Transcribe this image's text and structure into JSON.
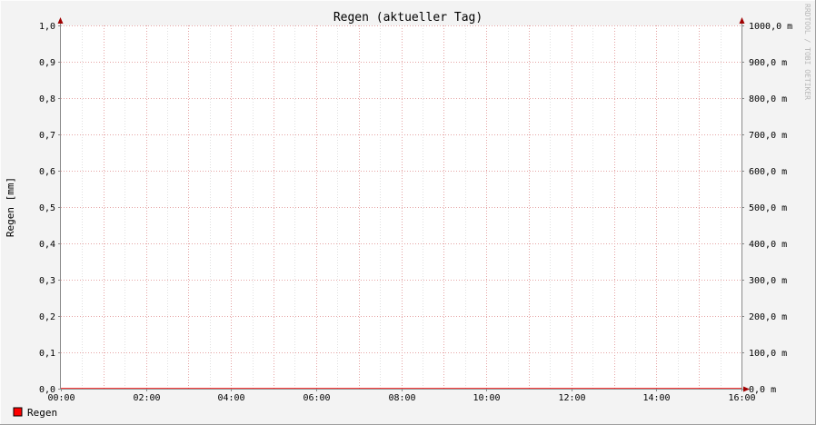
{
  "chart_data": {
    "type": "line",
    "title": "Regen (aktueller Tag)",
    "ylabel": "Regen [mm]",
    "x_ticks": [
      "00:00",
      "02:00",
      "04:00",
      "06:00",
      "08:00",
      "10:00",
      "12:00",
      "14:00",
      "16:00"
    ],
    "xlim": [
      "00:00",
      "16:00"
    ],
    "y_ticks": [
      "0,0",
      "0,1",
      "0,2",
      "0,3",
      "0,4",
      "0,5",
      "0,6",
      "0,7",
      "0,8",
      "0,9",
      "1,0"
    ],
    "ylim": [
      0,
      1.0
    ],
    "y2_ticks": [
      "0,0 m",
      "100,0 m",
      "200,0 m",
      "300,0 m",
      "400,0 m",
      "500,0 m",
      "600,0 m",
      "700,0 m",
      "800,0 m",
      "900,0 m",
      "1000,0 m"
    ],
    "y2lim": [
      0,
      1000
    ],
    "grid": true,
    "legend_position": "bottom-left",
    "series": [
      {
        "name": "Regen",
        "color": "#ff0000",
        "x": [
          "00:00",
          "16:00"
        ],
        "values": [
          0,
          0
        ]
      }
    ],
    "watermark": "RRDTOOL / TOBI OETIKER"
  }
}
